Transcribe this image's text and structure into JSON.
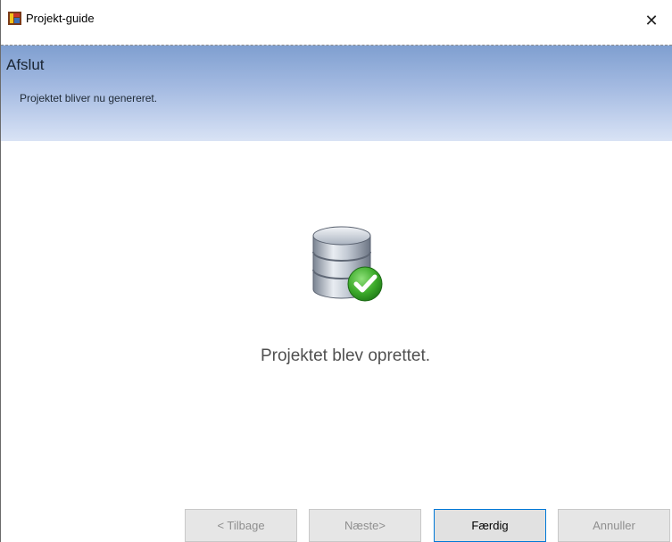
{
  "window": {
    "title": "Projekt-guide",
    "icon": "app-icon",
    "close_glyph": "✕"
  },
  "header": {
    "title": "Afslut",
    "subtitle": "Projektet bliver nu genereret."
  },
  "main": {
    "icon": "database-check-icon",
    "status": "Projektet blev oprettet."
  },
  "buttons": {
    "back": "< Tilbage",
    "next": "Næste>",
    "finish": "Færdig",
    "cancel": "Annuller"
  },
  "colors": {
    "accent": "#0078d7",
    "success": "#3caa2a"
  }
}
